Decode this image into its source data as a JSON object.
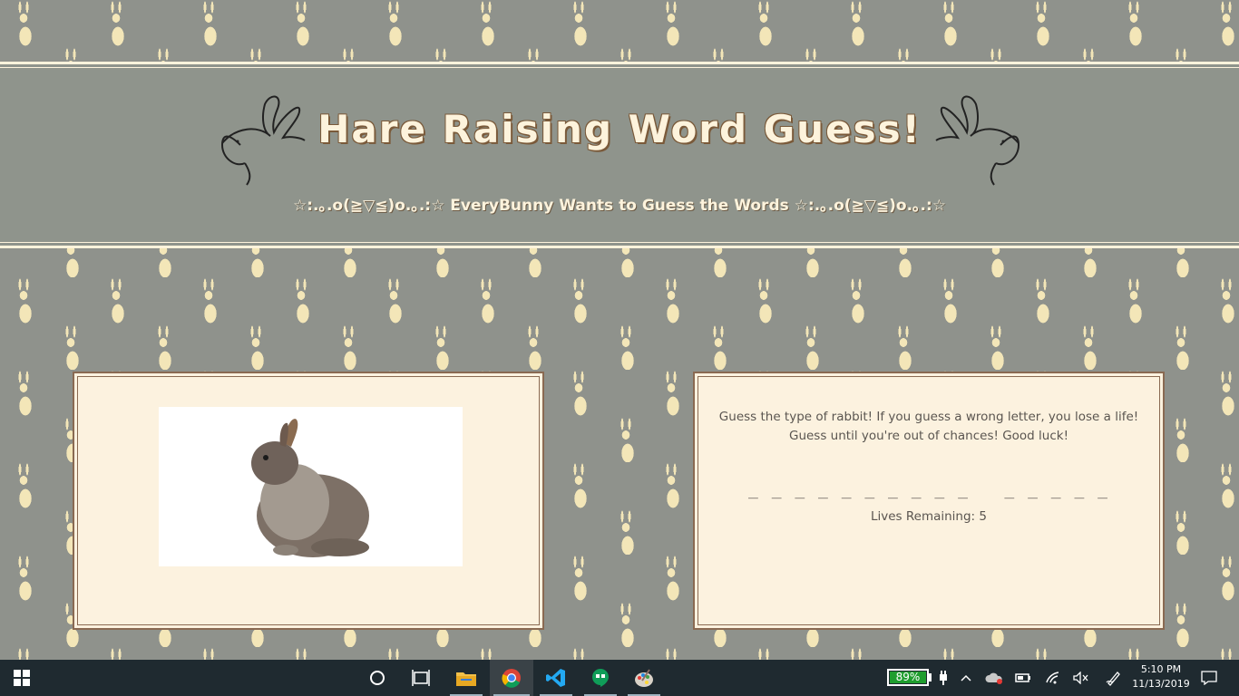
{
  "header": {
    "title": "Hare Raising Word Guess!",
    "subtitle": "☆:.｡.o(≧▽≦)o.｡.:☆ EveryBunny Wants to Guess the Words ☆:.｡.o(≧▽≦)o.｡.:☆"
  },
  "game": {
    "instructions_line1": "Guess the type of rabbit! If you guess a wrong letter, you lose a life!",
    "instructions_line2": "Guess until you're out of chances! Good luck!",
    "word_blanks": "_ _ _ _ _ _ _ _ _ _   _ _ _ _ _",
    "lives_label": "Lives Remaining: 5"
  },
  "taskbar": {
    "battery_percent": "89%",
    "time": "5:10 PM",
    "date": "11/13/2019",
    "apps": [
      "start-icon",
      "cortana-icon",
      "task-view-icon",
      "file-explorer-icon",
      "chrome-icon",
      "vscode-icon",
      "hangouts-icon",
      "paint-icon"
    ]
  },
  "colors": {
    "background": "#8f928c",
    "cream": "#fcf2df",
    "border": "#8a6a52",
    "battery_green": "#1f9d2e"
  }
}
